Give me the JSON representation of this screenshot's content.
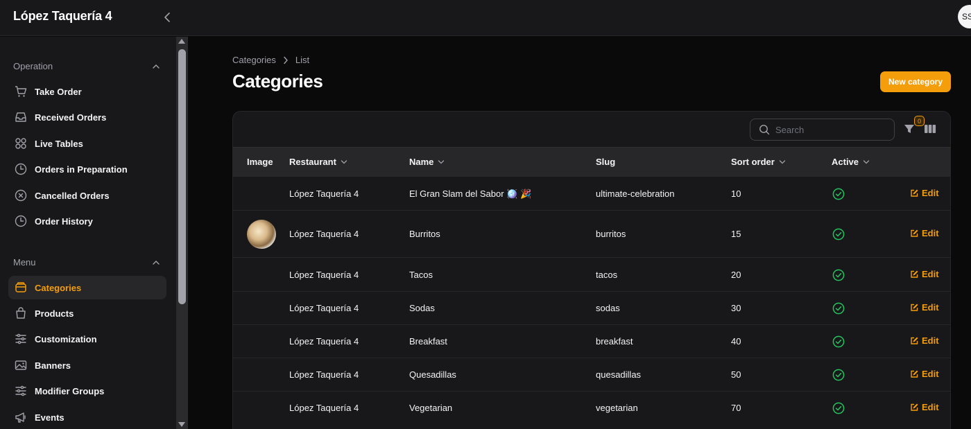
{
  "app": {
    "title": "López Taquería 4",
    "user_initials": "SS"
  },
  "sidebar": {
    "groups": [
      {
        "label": "Operation",
        "items": [
          {
            "label": "Take Order",
            "icon": "cart-icon"
          },
          {
            "label": "Received Orders",
            "icon": "inbox-icon"
          },
          {
            "label": "Live Tables",
            "icon": "grid-icon"
          },
          {
            "label": "Orders in Preparation",
            "icon": "clock-icon"
          },
          {
            "label": "Cancelled Orders",
            "icon": "x-circle-icon"
          },
          {
            "label": "Order History",
            "icon": "clock-icon"
          }
        ]
      },
      {
        "label": "Menu",
        "items": [
          {
            "label": "Categories",
            "icon": "tray-icon",
            "active": true
          },
          {
            "label": "Products",
            "icon": "bag-icon"
          },
          {
            "label": "Customization",
            "icon": "sliders-icon"
          },
          {
            "label": "Banners",
            "icon": "image-icon"
          },
          {
            "label": "Modifier Groups",
            "icon": "sliders-icon"
          },
          {
            "label": "Events",
            "icon": "megaphone-icon"
          }
        ]
      }
    ]
  },
  "breadcrumb": [
    "Categories",
    "List"
  ],
  "page": {
    "title": "Categories",
    "new_button": "New category"
  },
  "table": {
    "search_placeholder": "Search",
    "filter_count": "0",
    "columns": [
      "Image",
      "Restaurant",
      "Name",
      "Slug",
      "Sort order",
      "Active"
    ],
    "edit_label": "Edit",
    "rows": [
      {
        "restaurant": "López Taquería 4",
        "name": "El Gran Slam del Sabor 🪩 🎉",
        "slug": "ultimate-celebration",
        "sort_order": "10",
        "active": true,
        "has_image": false
      },
      {
        "restaurant": "López Taquería 4",
        "name": "Burritos",
        "slug": "burritos",
        "sort_order": "15",
        "active": true,
        "has_image": true
      },
      {
        "restaurant": "López Taquería 4",
        "name": "Tacos",
        "slug": "tacos",
        "sort_order": "20",
        "active": true,
        "has_image": false
      },
      {
        "restaurant": "López Taquería 4",
        "name": "Sodas",
        "slug": "sodas",
        "sort_order": "30",
        "active": true,
        "has_image": false
      },
      {
        "restaurant": "López Taquería 4",
        "name": "Breakfast",
        "slug": "breakfast",
        "sort_order": "40",
        "active": true,
        "has_image": false
      },
      {
        "restaurant": "López Taquería 4",
        "name": "Quesadillas",
        "slug": "quesadillas",
        "sort_order": "50",
        "active": true,
        "has_image": false
      },
      {
        "restaurant": "López Taquería 4",
        "name": "Vegetarian",
        "slug": "vegetarian",
        "sort_order": "70",
        "active": true,
        "has_image": false
      }
    ]
  },
  "colors": {
    "accent": "#f59e0b",
    "success": "#22c55e",
    "background": "#0a0a0b",
    "surface": "#18181b"
  }
}
